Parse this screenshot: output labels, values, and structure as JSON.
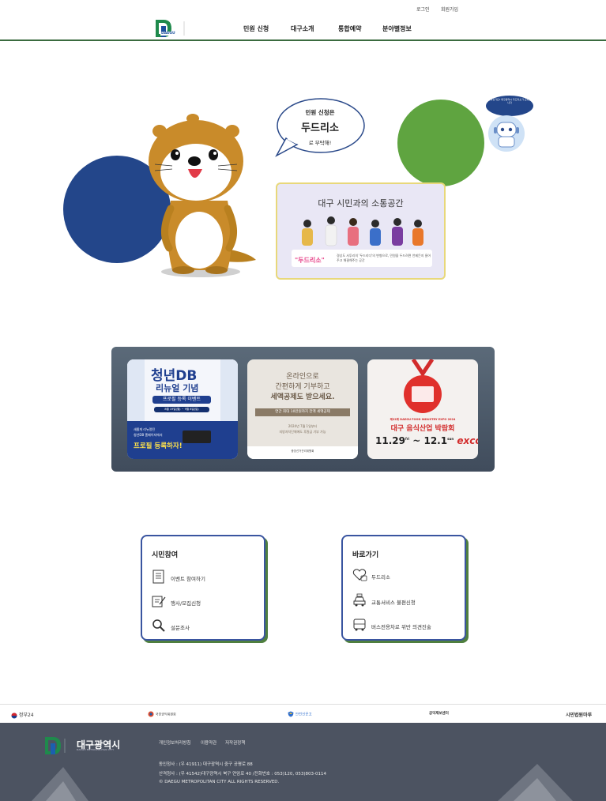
{
  "header": {
    "util_links": [
      "로그인",
      "회원가입"
    ],
    "logo_text": "DAEGU",
    "nav": [
      "민원 신청",
      "대구소개",
      "통합예약",
      "분야별정보"
    ]
  },
  "hero": {
    "speech_line1": "민원 신청은",
    "speech_brand": "두드리소",
    "speech_line2": "로 부탁해!",
    "community_title": "대구 시민과의 소통공간",
    "community_brand": "\"두드리소\"",
    "community_desc": "경상도 사투리의 '두드리다'의 변형으로, 민원을 두드려면 언제든지 들어주고 해결해주는 공간",
    "robot_bubble_text": "궁금하신가요? 대구광역시 두드리소가 도와드립니다",
    "colors": {
      "blue": "#23468a",
      "green": "#5fa440",
      "mascot": "#c98b2a"
    }
  },
  "banner": {
    "card1": {
      "title": "청년DB",
      "subtitle": "리뉴얼 기념",
      "tag": "프로필 등록 이벤트",
      "dates": "8월 19일(월) ~ 9월 8일(일)",
      "bottom1": "새롭게 리뉴얼된",
      "bottom2": "청년DB 홈페이지에서",
      "cta": "프로필 등록하자!"
    },
    "card2": {
      "line1": "온라인으로",
      "line2": "간편하게 기부하고",
      "line3": "세액공제도 받으세요.",
      "bar": "연간 최대 10만원까지 전액 세액공제",
      "small1": "2024년 7월 1일부터",
      "small2": "지방자치단체에도 후원금 기부 가능",
      "org": "중앙선거관리위원회"
    },
    "card3": {
      "expo_en": "제22회 DAEGU FOOD INDUSTRY EXPO 2024",
      "expo_ko": "대구 음식산업 박람회",
      "dates": "11.29",
      "dates_sup1": "fri",
      "dates_to": "~ 12.1",
      "dates_sup2": "sun",
      "venue": "exco"
    }
  },
  "citizen": {
    "title": "시민참여",
    "items": [
      "이벤트 참여하기",
      "행사/모집신청",
      "설문조사"
    ]
  },
  "shortcut": {
    "title": "바로가기",
    "items": [
      "두드리소",
      "교통서비스 불편신청",
      "버스전용차로 위반 의견진술"
    ]
  },
  "partners": [
    "정부24",
    "국민권익위원회",
    "안전신문고",
    "공익제보센터",
    "시민법원마루"
  ],
  "footer": {
    "name": "대구광역시",
    "sub": "DAEGU METROPOLITAN CITY",
    "links": [
      "개인정보처리방침",
      "이용약관",
      "저작권정책"
    ],
    "addr1": "동인청사 : (우 41911) 대구광역시 중구 공평로 88",
    "addr2": "산격청사 : (우 41542)대구광역시 북구 연암로 40 /전화번호 : 053)120, 053)803-0114",
    "copyright": "© DAEGU METROPOLITAN CITY ALL RIGHTS RESERVED."
  }
}
